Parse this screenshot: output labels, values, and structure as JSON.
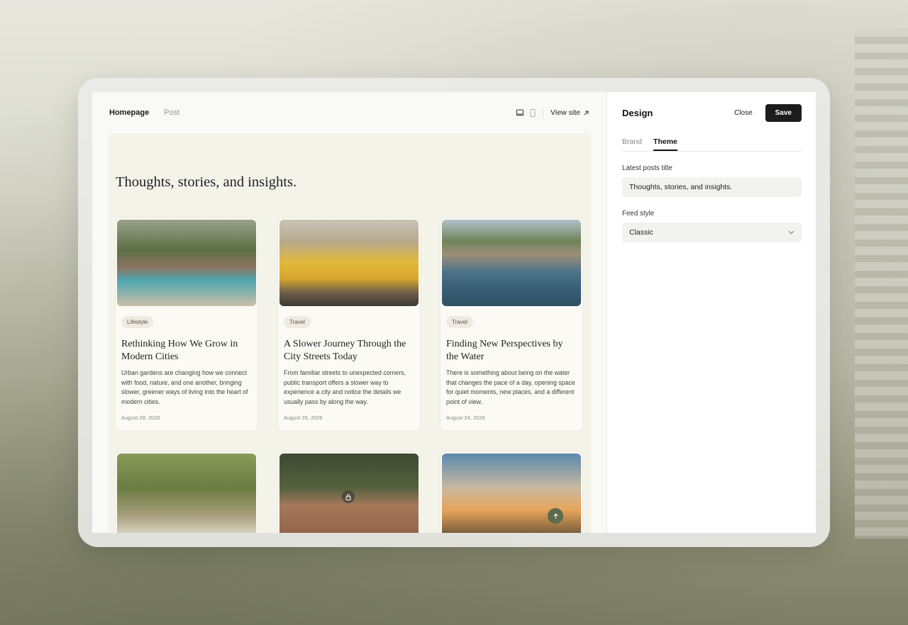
{
  "preview": {
    "tabs": [
      "Homepage",
      "Post"
    ],
    "view_site": "View site",
    "heading": "Thoughts, stories, and insights.",
    "posts": [
      {
        "tag": "Lifestyle",
        "title": "Rethinking How We Grow in Modern Cities",
        "excerpt": "Urban gardens are changing how we connect with food, nature, and one another, bringing slower, greener ways of living into the heart of modern cities.",
        "date": "August 28, 2026"
      },
      {
        "tag": "Travel",
        "title": "A Slower Journey Through the City Streets Today",
        "excerpt": "From familiar streets to unexpected corners, public transport offers a slower way to experience a city and notice the details we usually pass by along the way.",
        "date": "August 26, 2026"
      },
      {
        "tag": "Travel",
        "title": "Finding New Perspectives by the Water",
        "excerpt": "There is something about being on the water that changes the pace of a day, opening space for quiet moments, new places, and a different point of view.",
        "date": "August 24, 2026"
      }
    ]
  },
  "panel": {
    "title": "Design",
    "close_label": "Close",
    "save_label": "Save",
    "tabs": [
      "Brand",
      "Theme"
    ],
    "active_tab": "Theme",
    "latest_posts_label": "Latest posts title",
    "latest_posts_value": "Thoughts, stories, and insights.",
    "feed_style_label": "Feed style",
    "feed_style_value": "Classic"
  },
  "colors": {
    "save_button_bg": "#1c1c1c",
    "canvas_bg": "#f4f3ea",
    "accent_green": "#5d6a4c"
  }
}
